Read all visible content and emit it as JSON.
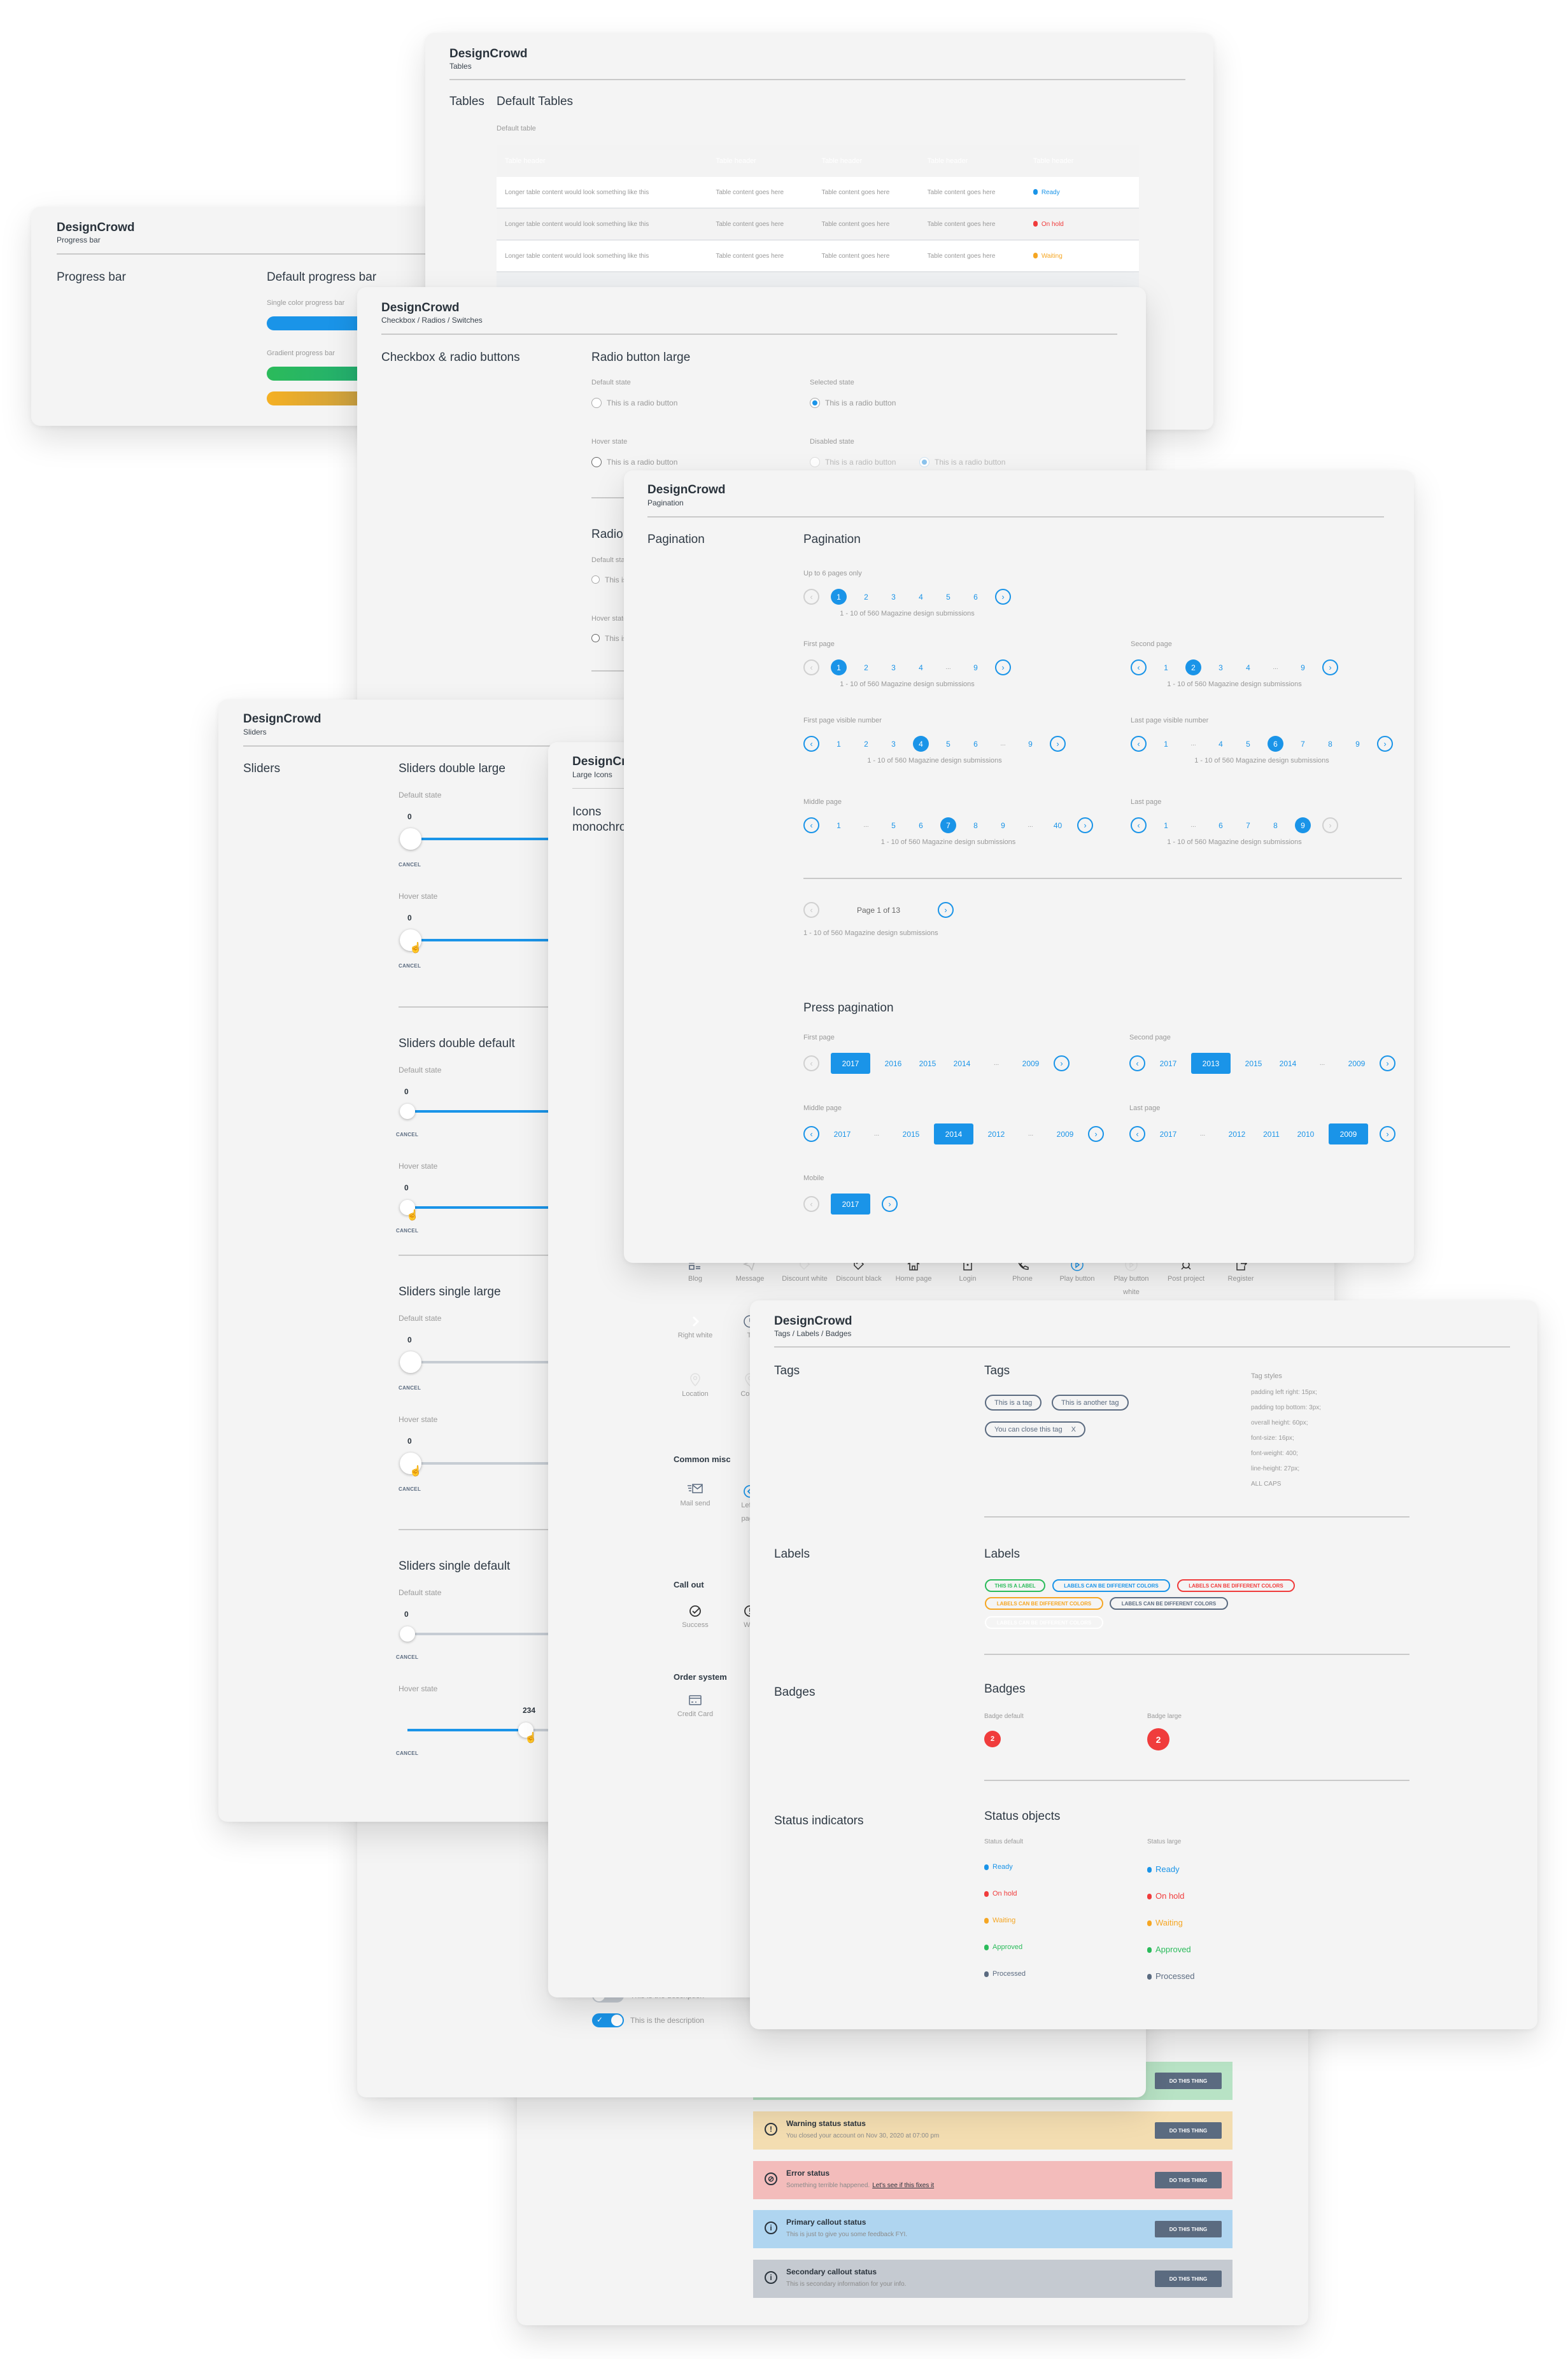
{
  "brand": "DesignCrowd",
  "colors": {
    "primary": "#1a94e8",
    "error": "#f03c3c",
    "warning": "#f5a623",
    "success": "#2bbb5b",
    "neutral": "#5b6b80"
  },
  "progress": {
    "subtitle": "Progress bar",
    "section": "Progress bar",
    "heading": "Default progress bar",
    "single_label": "Single color progress bar",
    "gradient_label": "Gradient progress bar"
  },
  "tables": {
    "subtitle": "Tables",
    "section": "Tables",
    "heading": "Default Tables",
    "caption": "Default table",
    "headers": [
      "Table header",
      "Table header",
      "Table header",
      "Table header",
      "Table header"
    ],
    "rows": [
      {
        "cells": [
          "Longer table content would look something like this",
          "Table content goes here",
          "Table content goes here",
          "Table content goes here"
        ],
        "status": "Ready",
        "color": "#1a94e8"
      },
      {
        "cells": [
          "Longer table content would look something like this",
          "Table content goes here",
          "Table content goes here",
          "Table content goes here"
        ],
        "status": "On hold",
        "color": "#f03c3c"
      },
      {
        "cells": [
          "Longer table content would look something like this",
          "Table content goes here",
          "Table content goes here",
          "Table content goes here"
        ],
        "status": "Waiting",
        "color": "#f5a623"
      }
    ]
  },
  "checkbox": {
    "subtitle": "Checkbox / Radios / Switches",
    "section": "Checkbox & radio buttons",
    "radio_large": {
      "heading": "Radio button large",
      "default_state": "Default state",
      "selected_state": "Selected state",
      "hover_state": "Hover state",
      "disabled_state": "Disabled state",
      "radio_label": "This is a radio button"
    },
    "radio_default": {
      "heading": "Radio button default",
      "default_state": "Default state",
      "hover_state": "Hover state",
      "radio_label": "This is a radio button"
    },
    "toggles": [
      {
        "label": "This is the description",
        "on": false
      },
      {
        "label": "This is the description",
        "on": true
      }
    ]
  },
  "pagination": {
    "subtitle": "Pagination",
    "section": "Pagination",
    "heading": "Pagination",
    "groups": [
      {
        "label": "Up to 6 pages only",
        "prev": "disabled",
        "next": "enabled",
        "items": [
          "1",
          "2",
          "3",
          "4",
          "5",
          "6"
        ],
        "active": "1",
        "caption": "1 - 10 of 560 Magazine design submissions"
      },
      {
        "label": "First page",
        "prev": "disabled",
        "next": "enabled",
        "items": [
          "1",
          "2",
          "3",
          "4",
          "...",
          "9"
        ],
        "active": "1",
        "caption": "1 - 10 of 560 Magazine design submissions"
      },
      {
        "label": "Second page",
        "prev": "enabled",
        "next": "enabled",
        "items": [
          "1",
          "2",
          "3",
          "4",
          "...",
          "9"
        ],
        "active": "2",
        "caption": "1 - 10 of 560 Magazine design submissions"
      },
      {
        "label": "First page visible number",
        "prev": "enabled",
        "next": "enabled",
        "items": [
          "1",
          "2",
          "3",
          "4",
          "5",
          "6",
          "...",
          "9"
        ],
        "active": "4",
        "caption": "1 - 10 of 560 Magazine design submissions"
      },
      {
        "label": "Last page visible number",
        "prev": "enabled",
        "next": "enabled",
        "items": [
          "1",
          "...",
          "4",
          "5",
          "6",
          "7",
          "8",
          "9"
        ],
        "active": "6",
        "caption": "1 - 10 of 560 Magazine design submissions"
      },
      {
        "label": "Middle page",
        "prev": "enabled",
        "next": "enabled",
        "items": [
          "1",
          "...",
          "5",
          "6",
          "7",
          "8",
          "9",
          "...",
          "40"
        ],
        "active": "7",
        "caption": "1 - 10 of 560 Magazine design submissions"
      },
      {
        "label": "Last page",
        "prev": "enabled",
        "next": "disabled",
        "items": [
          "1",
          "...",
          "6",
          "7",
          "8",
          "9"
        ],
        "active": "9",
        "caption": "1 - 10 of 560 Magazine design submissions"
      }
    ],
    "simple": {
      "text": "Page 1 of 13",
      "prev": "disabled",
      "next": "enabled",
      "caption": "1 - 10 of 560 Magazine design submissions"
    },
    "press_heading": "Press pagination",
    "press": [
      {
        "label": "First page",
        "prev": "disabled",
        "next": "enabled",
        "items": [
          "2017",
          "2016",
          "2015",
          "2014",
          "...",
          "2009"
        ],
        "active": "2017"
      },
      {
        "label": "Second page",
        "prev": "enabled",
        "next": "enabled",
        "items": [
          "2017",
          "2013",
          "2015",
          "2014",
          "...",
          "2009"
        ],
        "active": "2013"
      },
      {
        "label": "Middle page",
        "prev": "enabled",
        "next": "enabled",
        "items": [
          "2017",
          "...",
          "2015",
          "2014",
          "2012",
          "...",
          "2009"
        ],
        "active": "2014"
      },
      {
        "label": "Last page",
        "prev": "enabled",
        "next": "enabled",
        "items": [
          "2017",
          "...",
          "2012",
          "2011",
          "2010",
          "2009"
        ],
        "active": "2009"
      },
      {
        "label": "Mobile",
        "prev": "disabled",
        "next": "enabled",
        "items": [
          "2017"
        ],
        "active": "2017"
      }
    ]
  },
  "sliders": {
    "subtitle": "Sliders",
    "section": "Sliders",
    "default_state": "Default state",
    "hover_state": "Hover state",
    "cancel": "CANCEL",
    "double_large": {
      "heading": "Sliders double large",
      "default_value": "0",
      "hover_value": "0"
    },
    "double_default": {
      "heading": "Sliders double default",
      "default_value": "0",
      "hover_value": "0"
    },
    "single_large": {
      "heading": "Sliders single large",
      "default_value": "0",
      "hover_value": "0"
    },
    "single_default": {
      "heading": "Sliders single default",
      "default_value": "0",
      "hover_value": "234"
    }
  },
  "icons": {
    "subtitle": "Large Icons",
    "section": "Icons monochrome",
    "row1": [
      {
        "icon": "blog-icon",
        "label": "Blog"
      },
      {
        "icon": "message-icon",
        "label": "Message"
      },
      {
        "icon": "discount-white-icon",
        "label": "Discount white"
      },
      {
        "icon": "discount-black-icon",
        "label": "Discount black"
      },
      {
        "icon": "home-icon",
        "label": "Home page"
      },
      {
        "icon": "login-icon",
        "label": "Login"
      },
      {
        "icon": "phone-icon",
        "label": "Phone"
      },
      {
        "icon": "play-icon",
        "label": "Play button"
      },
      {
        "icon": "play-white-icon",
        "label": "Play button white"
      },
      {
        "icon": "post-project-icon",
        "label": "Post project"
      },
      {
        "icon": "register-icon",
        "label": "Register"
      }
    ],
    "right_white": "Right white",
    "time_partial": "Ti",
    "location": "Location",
    "contact_partial": "Conta",
    "common_misc": "Common misc",
    "mail_send": "Mail send",
    "left_partial_1": "Left a",
    "left_partial_2": "pagin",
    "call_out": "Call out",
    "success": "Success",
    "warning_partial": "War",
    "order_system": "Order system",
    "credit_card": "Credit Card"
  },
  "tags": {
    "subtitle": "Tags / Labels / Badges",
    "tags_section": "Tags",
    "tags_heading": "Tags",
    "tag_items": [
      "This is a tag",
      "This is another tag"
    ],
    "closable_tag": "You can close this tag",
    "close_glyph": "X",
    "styles_title": "Tag styles",
    "styles": [
      "padding left right: 15px;",
      "padding top bottom: 3px;",
      "overall height: 60px;",
      "font-size: 16px;",
      "font-weight: 400;",
      "line-height: 27px;",
      "ALL CAPS"
    ],
    "labels_section": "Labels",
    "labels_heading": "Labels",
    "labels": [
      {
        "text": "THIS IS A LABEL",
        "color": "#2bbb5b"
      },
      {
        "text": "LABELS CAN BE DIFFERENT COLORS",
        "color": "#1a94e8"
      },
      {
        "text": "LABELS CAN BE DIFFERENT COLORS",
        "color": "#f03c3c"
      },
      {
        "text": "LABELS CAN BE DIFFERENT COLORS",
        "color": "#f5a623"
      },
      {
        "text": "LABELS CAN BE DIFFERENT COLORS",
        "color": "#5b6b80"
      },
      {
        "text": "LABELS CAN BE DIFFERENT COLORS",
        "color": "#ffffff"
      }
    ],
    "badges_section": "Badges",
    "badges_heading": "Badges",
    "badge_default_label": "Badge default",
    "badge_large_label": "Badge large",
    "badge_value": "2",
    "status_section": "Status indicators",
    "status_heading": "Status objects",
    "status_default_label": "Status default",
    "status_large_label": "Status large",
    "statuses": [
      {
        "text": "Ready",
        "color": "#1a94e8"
      },
      {
        "text": "On hold",
        "color": "#f03c3c"
      },
      {
        "text": "Waiting",
        "color": "#f5a623"
      },
      {
        "text": "Approved",
        "color": "#2bbb5b"
      },
      {
        "text": "Processed",
        "color": "#5b6b80"
      }
    ]
  },
  "callouts": [
    {
      "type": "success",
      "title": "",
      "desc": "",
      "button": "DO THIS THING",
      "bg": "#b8e3c5",
      "icon": "check-icon"
    },
    {
      "type": "warning",
      "title": "Warning status status",
      "desc": "You closed your account on Nov 30, 2020 at 07:00 pm",
      "button": "DO THIS THING",
      "bg": "#f3ddb1",
      "icon": "warning-icon"
    },
    {
      "type": "error",
      "title": "Error status",
      "desc": "Something terrible happened.",
      "link": "Let's see if this fixes it",
      "button": "DO THIS THING",
      "bg": "#f3bcbb",
      "icon": "error-icon"
    },
    {
      "type": "primary",
      "title": "Primary callout status",
      "desc": "This is just to give you some feedback FYI.",
      "button": "DO THIS THING",
      "bg": "#afd5f0",
      "icon": "info-icon"
    },
    {
      "type": "secondary",
      "title": "Secondary callout status",
      "desc": "This is secondary information for your info.",
      "button": "DO THIS THING",
      "bg": "#c5cad1",
      "icon": "info-icon"
    }
  ]
}
